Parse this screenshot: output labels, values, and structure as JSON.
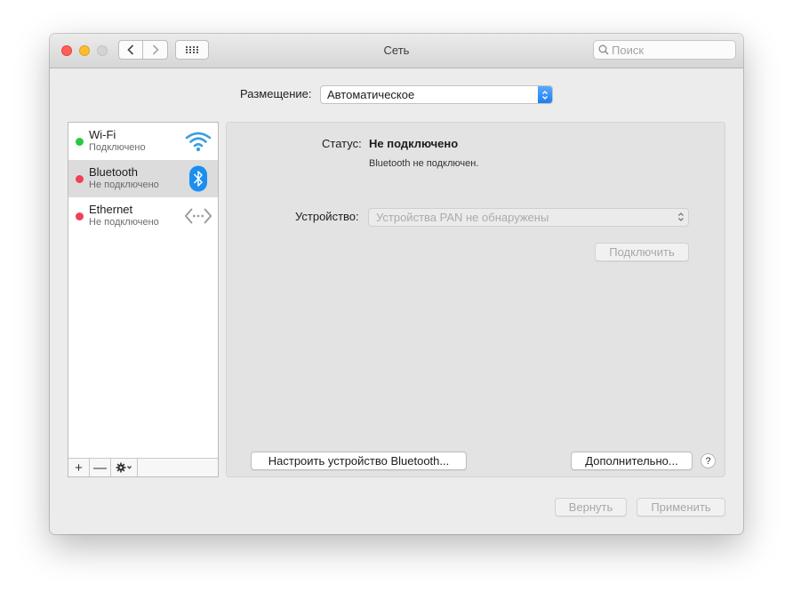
{
  "window": {
    "title": "Сеть",
    "search_placeholder": "Поиск"
  },
  "location": {
    "label": "Размещение:",
    "value": "Автоматическое"
  },
  "services": [
    {
      "name": "Wi-Fi",
      "status": "Подключено",
      "status_color": "#2ac840",
      "icon": "wifi-icon"
    },
    {
      "name": "Bluetooth",
      "status": "Не подключено",
      "status_color": "#ee4256",
      "icon": "bluetooth-icon"
    },
    {
      "name": "Ethernet",
      "status": "Не подключено",
      "status_color": "#ee4256",
      "icon": "ethernet-icon"
    }
  ],
  "sidebar_footer": {
    "add": "+",
    "remove": "—"
  },
  "detail": {
    "status_label": "Статус:",
    "status_value": "Не подключено",
    "status_desc": "Bluetooth не подключен.",
    "device_label": "Устройство:",
    "device_value": "Устройства PAN не обнаружены",
    "connect_label": "Подключить",
    "setup_label": "Настроить устройство Bluetooth...",
    "advanced_label": "Дополнительно...",
    "help_label": "?"
  },
  "footer": {
    "revert_label": "Вернуть",
    "apply_label": "Применить"
  },
  "colors": {
    "accent": "#1d7df4",
    "selected_row": "#dcdcdc"
  }
}
